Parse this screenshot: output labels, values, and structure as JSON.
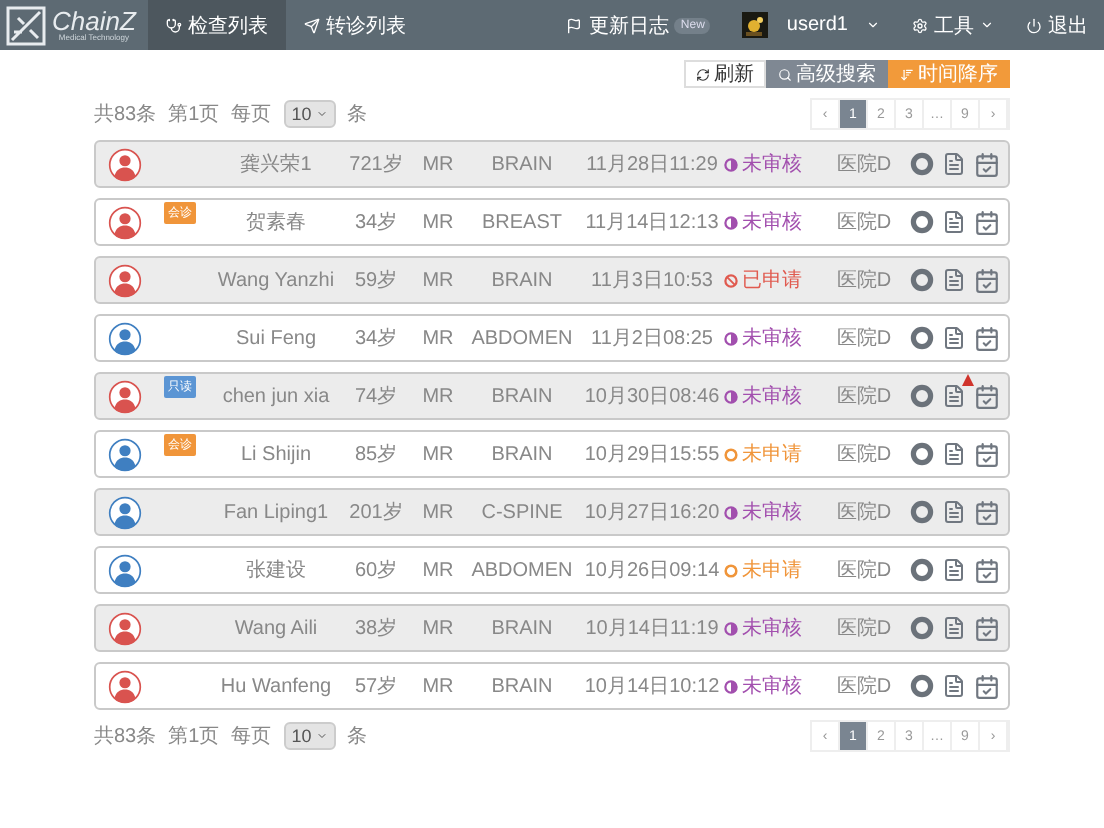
{
  "navbar": {
    "logo": "ChainZ",
    "logo_subtitle": "Medical Technology",
    "tabs": [
      {
        "label": "检查列表",
        "selected": true
      },
      {
        "label": "转诊列表",
        "selected": false
      }
    ],
    "changelog": "更新日志",
    "changelog_badge": "New",
    "user": "userd1",
    "tools": "工具",
    "logout": "退出"
  },
  "toolbar": {
    "buttons": [
      {
        "label": "刷新",
        "kind": "refresh"
      },
      {
        "label": "高级搜索",
        "kind": "search"
      },
      {
        "label": "时间降序",
        "kind": "sort"
      }
    ]
  },
  "pagination_top": {
    "total": "共83条",
    "page": "第1页",
    "per_page_label": "每页",
    "per_page": "10",
    "unit": "条",
    "pages": [
      {
        "label": "‹",
        "selected": false
      },
      {
        "label": "1",
        "selected": true
      },
      {
        "label": "2",
        "selected": false
      },
      {
        "label": "3",
        "selected": false
      },
      {
        "label": "…",
        "selected": false
      },
      {
        "label": "9",
        "selected": false
      },
      {
        "label": "›",
        "selected": false
      }
    ]
  },
  "rows": [
    {
      "avatar": {
        "kind": "female"
      },
      "tag": null,
      "name": "龚兴荣1",
      "age": "721岁",
      "modality": "MR",
      "body_part": "BRAIN",
      "time": "11月28日11:29",
      "status": {
        "label": "未审核",
        "kind": "review"
      },
      "hospital": "医院D",
      "alert": false
    },
    {
      "avatar": {
        "kind": "female"
      },
      "tag": {
        "label": "会诊",
        "kind": "consult"
      },
      "name": "贺素春",
      "age": "34岁",
      "modality": "MR",
      "body_part": "BREAST",
      "time": "11月14日12:13",
      "status": {
        "label": "未审核",
        "kind": "review"
      },
      "hospital": "医院D",
      "alert": false
    },
    {
      "avatar": {
        "kind": "female"
      },
      "tag": null,
      "name": "Wang Yanzhi",
      "age": "59岁",
      "modality": "MR",
      "body_part": "BRAIN",
      "time": "11月3日10:53",
      "status": {
        "label": "已申请",
        "kind": "applied"
      },
      "hospital": "医院D",
      "alert": false
    },
    {
      "avatar": {
        "kind": "male"
      },
      "tag": null,
      "name": "Sui Feng",
      "age": "34岁",
      "modality": "MR",
      "body_part": "ABDOMEN",
      "time": "11月2日08:25",
      "status": {
        "label": "未审核",
        "kind": "review"
      },
      "hospital": "医院D",
      "alert": false
    },
    {
      "avatar": {
        "kind": "female"
      },
      "tag": {
        "label": "只读",
        "kind": "readonly"
      },
      "name": "chen jun xia",
      "age": "74岁",
      "modality": "MR",
      "body_part": "BRAIN",
      "time": "10月30日08:46",
      "status": {
        "label": "未审核",
        "kind": "review"
      },
      "hospital": "医院D",
      "alert": true
    },
    {
      "avatar": {
        "kind": "male"
      },
      "tag": {
        "label": "会诊",
        "kind": "consult"
      },
      "name": "Li Shijin",
      "age": "85岁",
      "modality": "MR",
      "body_part": "BRAIN",
      "time": "10月29日15:55",
      "status": {
        "label": "未申请",
        "kind": "unapplied"
      },
      "hospital": "医院D",
      "alert": false
    },
    {
      "avatar": {
        "kind": "male"
      },
      "tag": null,
      "name": "Fan Liping1",
      "age": "201岁",
      "modality": "MR",
      "body_part": "C-SPINE",
      "time": "10月27日16:20",
      "status": {
        "label": "未审核",
        "kind": "review"
      },
      "hospital": "医院D",
      "alert": false
    },
    {
      "avatar": {
        "kind": "male"
      },
      "tag": null,
      "name": "张建设",
      "age": "60岁",
      "modality": "MR",
      "body_part": "ABDOMEN",
      "time": "10月26日09:14",
      "status": {
        "label": "未申请",
        "kind": "unapplied"
      },
      "hospital": "医院D",
      "alert": false
    },
    {
      "avatar": {
        "kind": "female"
      },
      "tag": null,
      "name": "Wang Aili",
      "age": "38岁",
      "modality": "MR",
      "body_part": "BRAIN",
      "time": "10月14日11:19",
      "status": {
        "label": "未审核",
        "kind": "review"
      },
      "hospital": "医院D",
      "alert": false
    },
    {
      "avatar": {
        "kind": "female"
      },
      "tag": null,
      "name": "Hu Wanfeng",
      "age": "57岁",
      "modality": "MR",
      "body_part": "BRAIN",
      "time": "10月14日10:12",
      "status": {
        "label": "未审核",
        "kind": "review"
      },
      "hospital": "医院D",
      "alert": false
    }
  ],
  "pagination_bottom": {
    "total": "共83条",
    "page": "第1页",
    "per_page_label": "每页",
    "per_page": "10",
    "unit": "条",
    "pages": [
      {
        "label": "‹",
        "selected": false
      },
      {
        "label": "1",
        "selected": true
      },
      {
        "label": "2",
        "selected": false
      },
      {
        "label": "3",
        "selected": false
      },
      {
        "label": "…",
        "selected": false
      },
      {
        "label": "9",
        "selected": false
      },
      {
        "label": "›",
        "selected": false
      }
    ]
  }
}
